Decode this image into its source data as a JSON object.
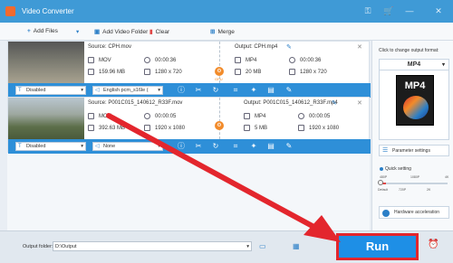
{
  "app": {
    "title": "Video Converter"
  },
  "toolbar": {
    "add_files": "Add Files",
    "add_video_folder": "Add Video Folder",
    "clear": "Clear",
    "merge": "Merge"
  },
  "items": [
    {
      "source_label": "Source: CPH.mov",
      "format": "MOV",
      "duration": "00:00:36",
      "size": "159.96 MB",
      "resolution": "1280 x 720",
      "output_label": "Output: CPH.mp4",
      "out_format": "MP4",
      "out_duration": "00:00:36",
      "out_size": "20 MB",
      "out_resolution": "1280 x 720",
      "gpu": "GPU",
      "subtitle": "Disabled",
      "audio": "English pcm_s16le (",
      "scene": "runners"
    },
    {
      "source_label": "Source: P001C015_140612_R33F.mov",
      "format": "MOV",
      "duration": "00:00:05",
      "size": "392.63 MB",
      "resolution": "1920 x 1080",
      "output_label": "Output: P001C015_140612_R33F.mp4",
      "out_format": "MP4",
      "out_duration": "00:00:05",
      "out_size": "5 MB",
      "out_resolution": "1920 x 1080",
      "subtitle": "Disabled",
      "audio": "None",
      "scene": "landscape"
    }
  ],
  "right_panel": {
    "label": "Click to change output format:",
    "format": "MP4",
    "format_image_text": "MP4",
    "parameter_settings": "Parameter settings",
    "quick_setting": "Quick setting",
    "quality_top": [
      "480P",
      "1080P",
      "4K"
    ],
    "quality_bottom": [
      "Default",
      "720P",
      "2K"
    ],
    "quality_level": 0.0,
    "hardware_acceleration": "Hardware acceleration"
  },
  "bottom": {
    "output_folder_label": "Output folder:",
    "output_folder_value": "D:\\Output",
    "run": "Run"
  },
  "colors": {
    "accent": "#2e8fd8",
    "highlight": "#e3262d",
    "brand": "#f26a2e"
  }
}
